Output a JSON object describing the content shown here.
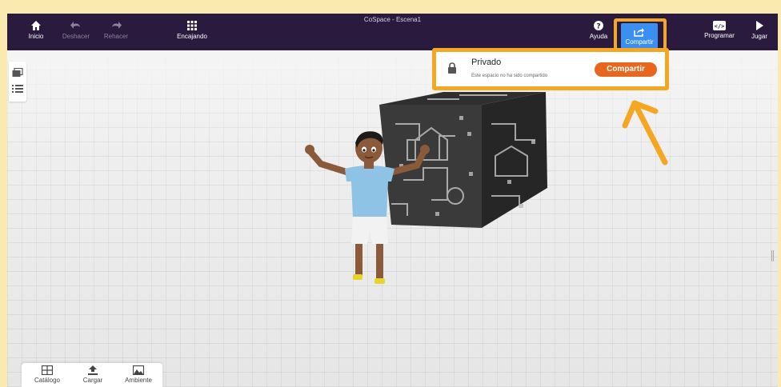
{
  "window": {
    "title": "CoSpace - Escena1"
  },
  "toolbar": {
    "home": "Inicio",
    "undo": "Deshacer",
    "redo": "Rehacer",
    "snap": "Encajando",
    "help": "Ayuda",
    "share": "Compartir",
    "code": "Programar",
    "play": "Jugar"
  },
  "share_popup": {
    "title": "Privado",
    "description": "Este espacio no ha sido compartido",
    "button": "Compartir"
  },
  "bottom_panel": {
    "catalog": "Catálogo",
    "upload": "Cargar",
    "environment": "Ambiente"
  },
  "colors": {
    "toolbar": "#2a1a3e",
    "accent": "#3b8ff0",
    "highlight": "#f5a623",
    "share_button": "#e8671f"
  }
}
